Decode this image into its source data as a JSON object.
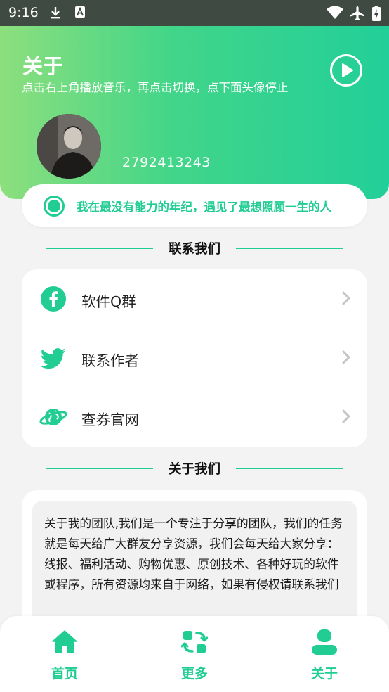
{
  "status_bar": {
    "time": "9:16",
    "icons": [
      "download-icon",
      "a-notification-icon",
      "wifi-icon",
      "airplane-icon",
      "battery-charging-icon"
    ]
  },
  "header": {
    "title": "关于",
    "subtitle": "点击右上角播放音乐，再点击切换，点下面头像停止",
    "play_icon": "play-icon",
    "qq_number": "2792413243"
  },
  "marquee": {
    "icon": "radio-dot-icon",
    "text": "我在最没有能力的年纪，遇见了最想照顾一生的人"
  },
  "contact_section": {
    "heading": "联系我们",
    "items": [
      {
        "label": "软件Q群",
        "icon": "facebook-icon"
      },
      {
        "label": "联系作者",
        "icon": "twitter-icon"
      },
      {
        "label": "查券官网",
        "icon": "planet-icon"
      }
    ]
  },
  "about_section": {
    "heading": "关于我们",
    "text": "关于我的团队,我们是一个专注于分享的团队，我们的任务就是每天给广大群友分享资源，我们会每天给大家分享：线报、福利活动、购物优惠、原创技术、各种好玩的软件或程序，所有资源均来自于网络，如果有侵权请联系我们"
  },
  "bottom_nav": {
    "items": [
      {
        "label": "首页",
        "icon": "home-icon"
      },
      {
        "label": "更多",
        "icon": "switch-icon"
      },
      {
        "label": "关于",
        "icon": "user-icon"
      }
    ]
  },
  "colors": {
    "accent": "#21cd93",
    "header_gradient_start": "#8ddf7d",
    "header_gradient_end": "#22cf99",
    "status_bar": "#3f4a43"
  }
}
